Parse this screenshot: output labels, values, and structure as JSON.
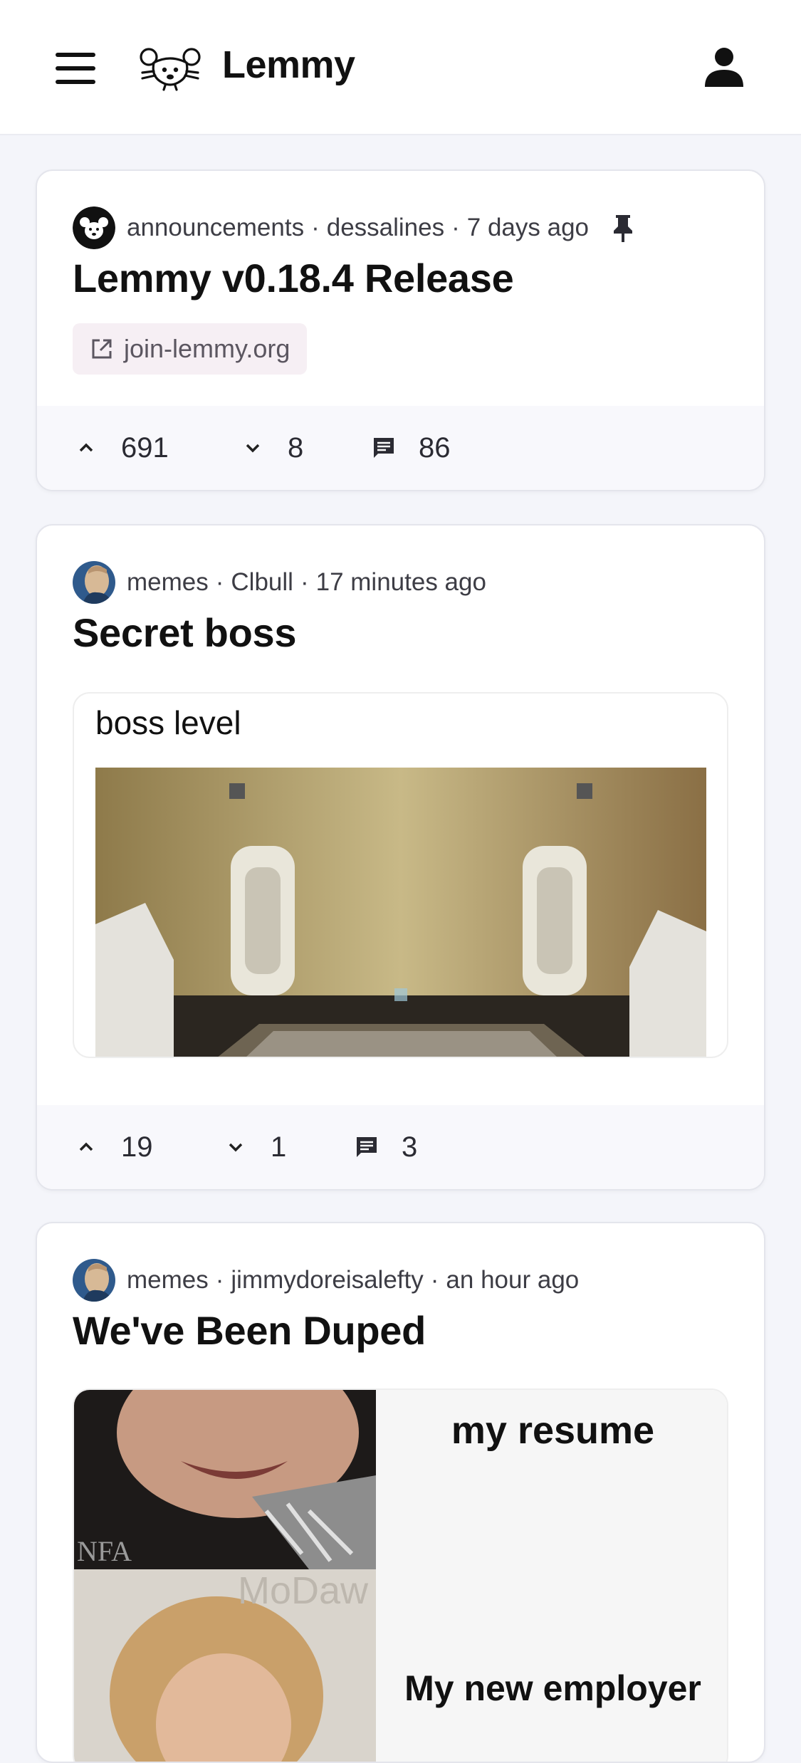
{
  "app": {
    "title": "Lemmy"
  },
  "header": {
    "menu_icon": "hamburger-menu-icon",
    "logo_icon": "lemmy-mouse-logo-icon",
    "account_icon": "user-account-icon"
  },
  "posts": [
    {
      "community": "announcements",
      "author": "dessalines",
      "time": "7 days ago",
      "title": "Lemmy v0.18.4 Release",
      "link": "join-lemmy.org",
      "upvotes": "691",
      "downvotes": "8",
      "comments": "86",
      "pinned": true
    },
    {
      "community": "memes",
      "author": "Clbull",
      "time": "17 minutes ago",
      "title": "Secret boss",
      "image_caption": "boss level",
      "upvotes": "19",
      "downvotes": "1",
      "comments": "3"
    },
    {
      "community": "memes",
      "author": "jimmydoreisalefty",
      "time": "an hour ago",
      "title": "We've Been Duped",
      "image_text_top": "my resume",
      "image_text_bottom": "My new employer",
      "image_watermark": "NFA"
    }
  ],
  "colors": {
    "accent_chip": "#f6eff4",
    "action_bar": "#f8f8fc",
    "background": "#f4f5fa"
  }
}
